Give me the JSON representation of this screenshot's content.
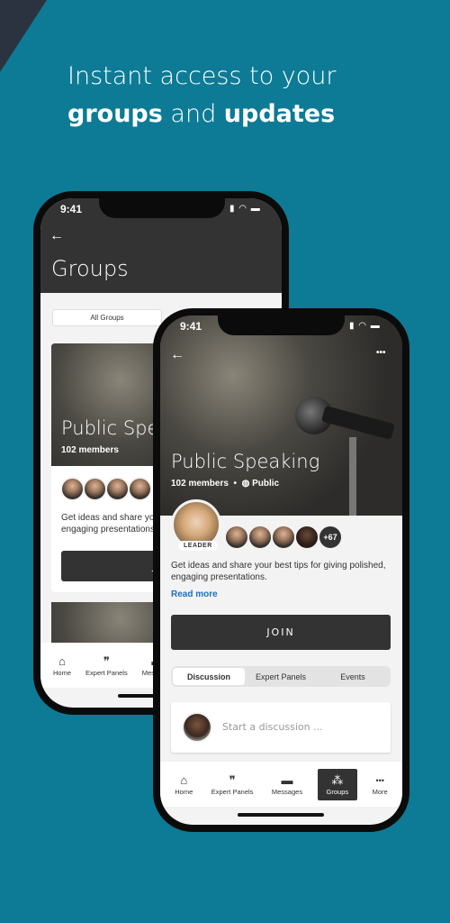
{
  "headline": {
    "line1": "Instant access to your",
    "bold1": "groups",
    "mid": "and",
    "bold2": "updates"
  },
  "colors": {
    "background": "#0d7b95",
    "header": "#333333",
    "link": "#1a6fc2"
  },
  "back_phone": {
    "time": "9:41",
    "title": "Groups",
    "back_icon": "arrow-left",
    "tab": "All Groups",
    "card": {
      "title": "Public Speaking",
      "members": "102 members",
      "desc": "Get ideas and share your best tips for giving polished, engaging presentations.",
      "join": "JOIN"
    },
    "nav": [
      {
        "label": "Home",
        "icon": "home"
      },
      {
        "label": "Expert Panels",
        "icon": "quote"
      },
      {
        "label": "Messages",
        "icon": "chat"
      }
    ]
  },
  "front_phone": {
    "time": "9:41",
    "back_icon": "arrow-left",
    "more_icon": "ellipsis",
    "title": "Public Speaking",
    "members": "102 members",
    "privacy": "Public",
    "leader_badge": "LEADER",
    "extra_members": "+67",
    "desc": "Get ideas and share your best tips for giving polished, engaging presentations.",
    "read_more": "Read more",
    "join": "JOIN",
    "tabs": [
      "Discussion",
      "Expert Panels",
      "Events"
    ],
    "discussion_placeholder": "Start a discussion ...",
    "nav": [
      {
        "label": "Home",
        "icon": "⌂"
      },
      {
        "label": "Expert Panels",
        "icon": "❞"
      },
      {
        "label": "Messages",
        "icon": "▬"
      },
      {
        "label": "Groups",
        "icon": "⁂"
      },
      {
        "label": "More",
        "icon": "•••"
      }
    ],
    "active_nav": "Groups"
  }
}
